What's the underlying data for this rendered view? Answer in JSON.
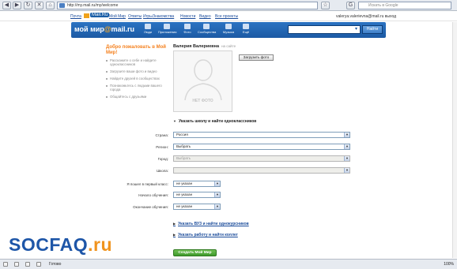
{
  "browser": {
    "url": "http://my.mail.ru/my/welcome",
    "search_placeholder": "Искать в Google",
    "status_text": "Готово",
    "zoom": "100%"
  },
  "portal": {
    "links": [
      "Почта",
      "Мой Мир",
      "Ответы",
      "Игры",
      "Знакомства",
      "Новости",
      "Видео",
      "Все проекты"
    ],
    "mail_badge": "Mail.Ru",
    "user": "valerya.valerievna@mail.ru  выход"
  },
  "header": {
    "logo_text": "мой мир",
    "logo_at": "@",
    "logo_domain": "mail.ru",
    "nav": [
      "Люди",
      "Приложения",
      "Фото",
      "Сообщества",
      "Музыка",
      "Ещё"
    ],
    "search_button": "Найти"
  },
  "welcome": {
    "title": "Добро пожаловать в Мой Мир!",
    "steps": [
      "Расскажите о себе и найдите одноклассников",
      "Загрузите ваши фото и видео",
      "Найдите друзей в сообществах",
      "Познакомьтесь с людьми вашего города",
      "Общайтесь с друзьями"
    ]
  },
  "profile": {
    "name": "Валерия Валериевна",
    "online": "на сайте",
    "no_photo": "НЕТ ФОТО",
    "upload_button": "Загрузить фото"
  },
  "school_section": {
    "toggle": "Указать школу и найти одноклассников",
    "fields": [
      {
        "label": "Страна:",
        "value": "Россия",
        "disabled": false
      },
      {
        "label": "Регион:",
        "value": "Выбрать",
        "disabled": false
      },
      {
        "label": "Город:",
        "value": "Выбрать",
        "disabled": true
      },
      {
        "label": "Школа:",
        "value": "",
        "disabled": true
      }
    ],
    "years": [
      {
        "label": "Я пошел в первый класс:",
        "value": "не указан"
      },
      {
        "label": "Начало обучения:",
        "value": "не указан"
      },
      {
        "label": "Окончание обучения:",
        "value": "не указан"
      }
    ]
  },
  "links": {
    "university": "Указать ВУЗ и найти однокурсников",
    "work": "Указать работу и найти коллег"
  },
  "create_button": "Создать Мой Мир",
  "watermark": {
    "main": "SOCFAQ",
    "suffix": ".ru"
  }
}
